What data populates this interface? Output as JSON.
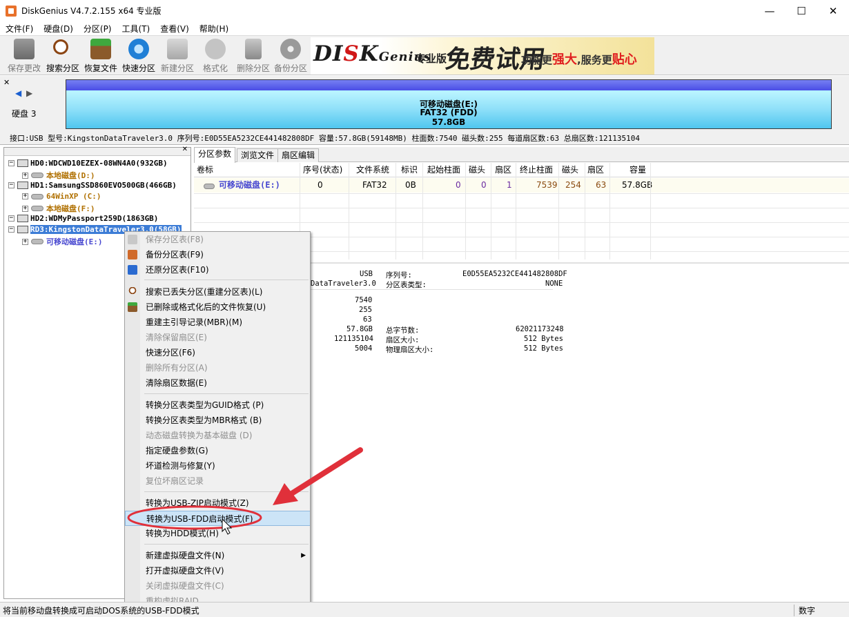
{
  "window": {
    "title": "DiskGenius V4.7.2.155 x64 专业版",
    "minimize": "—",
    "maximize": "☐",
    "close": "✕"
  },
  "menu": [
    "文件(F)",
    "硬盘(D)",
    "分区(P)",
    "工具(T)",
    "查看(V)",
    "帮助(H)"
  ],
  "toolbar": {
    "buttons": [
      {
        "label": "保存更改",
        "icon": "save-disk-icon",
        "enabled": false
      },
      {
        "label": "搜索分区",
        "icon": "magnifier-icon",
        "enabled": true
      },
      {
        "label": "恢复文件",
        "icon": "recover-box-icon",
        "enabled": true
      },
      {
        "label": "快速分区",
        "icon": "quick-partition-icon",
        "enabled": true
      },
      {
        "label": "新建分区",
        "icon": "new-partition-icon",
        "enabled": false
      },
      {
        "label": "格式化",
        "icon": "format-icon",
        "enabled": false
      },
      {
        "label": "删除分区",
        "icon": "trash-icon",
        "enabled": false
      },
      {
        "label": "备份分区",
        "icon": "backup-icon",
        "enabled": false
      }
    ]
  },
  "banner": {
    "logo_a": "DI",
    "logo_b": "S",
    "logo_c": "K",
    "logo_d": "Genius",
    "edition": "专业版",
    "free": "免费试用",
    "slogan_a": "功能更",
    "slogan_b": "强大",
    "slogan_c": ",服务更",
    "slogan_d": "贴心"
  },
  "disk_panel": {
    "label": "硬盘 3",
    "bar_line1": "可移动磁盘(E:)",
    "bar_line2": "FAT32 (FDD)",
    "bar_line3": "57.8GB",
    "info": "接口:USB  型号:KingstonDataTraveler3.0  序列号:E0D55EA5232CE441482808DF  容量:57.8GB(59148MB)  柱面数:7540  磁头数:255  每道扇区数:63  总扇区数:121135104"
  },
  "tree": [
    {
      "label": "HD0:WDCWD10EZEX-08WN4A0(932GB)",
      "type": "disk",
      "color": "#000000"
    },
    {
      "label": "本地磁盘(D:)",
      "type": "partition",
      "color": "#b07000"
    },
    {
      "label": "HD1:SamsungSSD860EVO500GB(466GB)",
      "type": "disk",
      "color": "#000000"
    },
    {
      "label": "64WinXP (C:)",
      "type": "partition",
      "color": "#b07000"
    },
    {
      "label": "本地磁盘(F:)",
      "type": "partition",
      "color": "#b07000"
    },
    {
      "label": "HD2:WDMyPassport259D(1863GB)",
      "type": "disk",
      "color": "#000000"
    },
    {
      "label": "RD3:KingstonDataTraveler3.0(58GB)",
      "type": "disk-selected",
      "color": "#ffffff"
    },
    {
      "label": "可移动磁盘(E:)",
      "type": "partition",
      "color": "#4848d0"
    }
  ],
  "tabs": [
    "分区参数",
    "浏览文件",
    "扇区编辑"
  ],
  "partition_table": {
    "headers": [
      "卷标",
      "序号(状态)",
      "文件系统",
      "标识",
      "起始柱面",
      "磁头",
      "扇区",
      "终止柱面",
      "磁头",
      "扇区",
      "容量"
    ],
    "rows": [
      [
        "可移动磁盘(E:)",
        "0",
        "FAT32",
        "0B",
        "0",
        "0",
        "1",
        "7539",
        "254",
        "63",
        "57.8GB"
      ]
    ]
  },
  "details": {
    "left_values": [
      "USB",
      "DataTraveler3.0",
      "7540",
      "255",
      "63",
      "57.8GB",
      "121135104",
      "5004"
    ],
    "right_labels": [
      "序列号:",
      "分区表类型:",
      "总字节数:",
      "扇区大小:",
      "物理扇区大小:"
    ],
    "right_values": [
      "E0D55EA5232CE441482808DF",
      "NONE",
      "62021173248",
      "512 Bytes",
      "512 Bytes"
    ]
  },
  "context_menu": {
    "items": [
      {
        "label": "保存分区表(F8)",
        "enabled": false,
        "icon": "save-table-icon"
      },
      {
        "label": "备份分区表(F9)",
        "enabled": true,
        "icon": "backup-table-icon"
      },
      {
        "label": "还原分区表(F10)",
        "enabled": true,
        "icon": "restore-table-icon"
      },
      {
        "label": "搜索已丢失分区(重建分区表)(L)",
        "enabled": true,
        "icon": "search-lost-icon"
      },
      {
        "label": "已删除或格式化后的文件恢复(U)",
        "enabled": true,
        "icon": "file-recover-icon"
      },
      {
        "label": "重建主引导记录(MBR)(M)",
        "enabled": true,
        "icon": ""
      },
      {
        "label": "清除保留扇区(E)",
        "enabled": false,
        "icon": ""
      },
      {
        "label": "快速分区(F6)",
        "enabled": true,
        "icon": ""
      },
      {
        "label": "删除所有分区(A)",
        "enabled": false,
        "icon": ""
      },
      {
        "label": "清除扇区数据(E)",
        "enabled": true,
        "icon": ""
      },
      {
        "label": "转换分区表类型为GUID格式 (P)",
        "enabled": true,
        "icon": ""
      },
      {
        "label": "转换分区表类型为MBR格式 (B)",
        "enabled": true,
        "icon": ""
      },
      {
        "label": "动态磁盘转换为基本磁盘 (D)",
        "enabled": false,
        "icon": ""
      },
      {
        "label": "指定硬盘参数(G)",
        "enabled": true,
        "icon": ""
      },
      {
        "label": "坏道检测与修复(Y)",
        "enabled": true,
        "icon": ""
      },
      {
        "label": "复位坏扇区记录",
        "enabled": false,
        "icon": ""
      },
      {
        "label": "转换为USB-ZIP启动模式(Z)",
        "enabled": true,
        "icon": ""
      },
      {
        "label": "转换为USB-FDD启动模式(F)",
        "enabled": true,
        "icon": "",
        "highlighted": true
      },
      {
        "label": "转换为HDD模式(H)",
        "enabled": true,
        "icon": ""
      },
      {
        "label": "新建虚拟硬盘文件(N)",
        "enabled": true,
        "icon": "",
        "submenu": true
      },
      {
        "label": "打开虚拟硬盘文件(V)",
        "enabled": true,
        "icon": ""
      },
      {
        "label": "关闭虚拟硬盘文件(C)",
        "enabled": false,
        "icon": ""
      },
      {
        "label": "重构虚拟RAID",
        "enabled": false,
        "icon": ""
      }
    ]
  },
  "status_bar": {
    "text": "将当前移动盘转换成可启动DOS系统的USB-FDD模式",
    "mode": "数字"
  },
  "colors": {
    "annotation_red": "#e0303a",
    "selection_blue": "#3c7cd6",
    "partition_bar": "#86e4fb"
  }
}
